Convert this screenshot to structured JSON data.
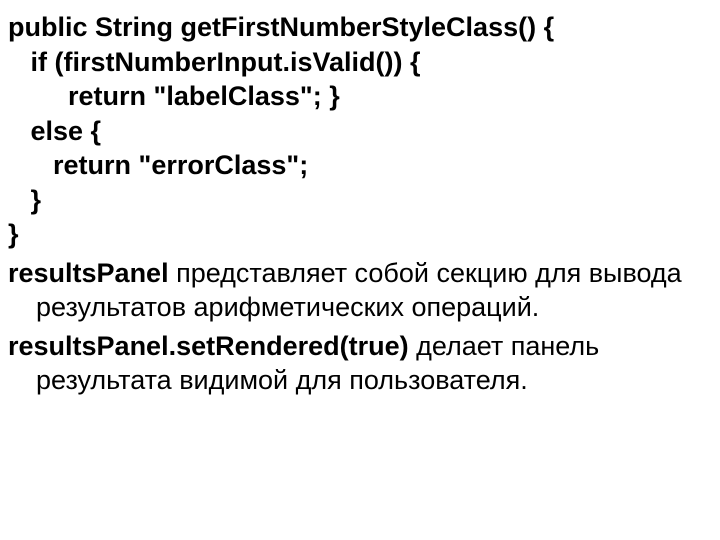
{
  "code": {
    "l1": "public String getFirstNumberStyleClass() {",
    "l2": "   if (firstNumberInput.isValid()) {",
    "l3": "        return \"labelClass\"; }",
    "l4": "   else {",
    "l5": "      return \"errorClass\";",
    "l6": "   }",
    "l7": "}"
  },
  "para1": {
    "lead": "resultsPanel",
    "rest": " представляет собой секцию для вывода результатов арифметических операций."
  },
  "para2": {
    "lead": "resultsPanel.setRendered(true)",
    "rest": " делает панель результата видимой для пользователя."
  }
}
